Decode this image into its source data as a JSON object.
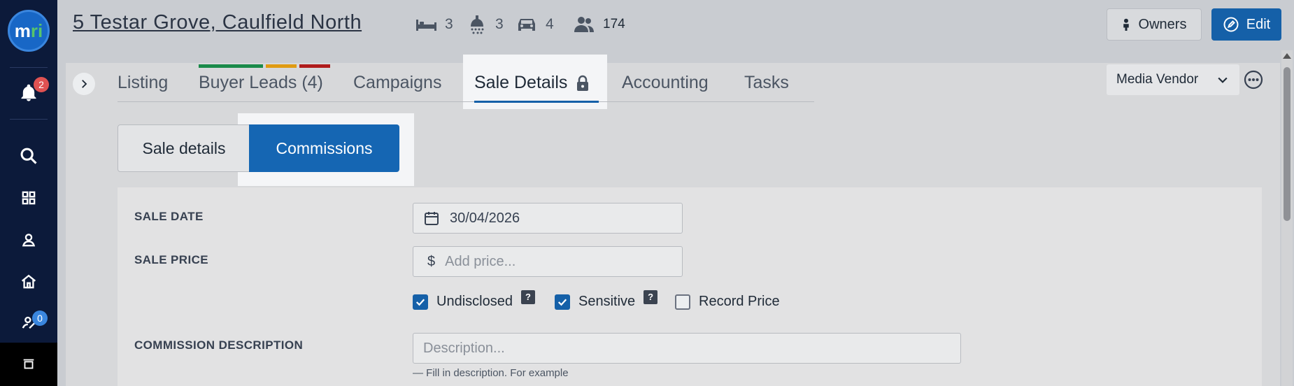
{
  "app": {
    "logo_text": "mri",
    "notifications_count": "2",
    "tasks_count": "0"
  },
  "header": {
    "address": "5 Testar Grove, Caulfield North",
    "bedrooms": "3",
    "bathrooms": "3",
    "car_spaces": "4",
    "contacts": "174",
    "owners_label": "Owners",
    "edit_label": "Edit"
  },
  "tabs": {
    "items": [
      {
        "label": "Listing"
      },
      {
        "label": "Buyer Leads (4)"
      },
      {
        "label": "Campaigns"
      },
      {
        "label": "Sale Details"
      },
      {
        "label": "Accounting"
      },
      {
        "label": "Tasks"
      }
    ],
    "active": "Sale Details",
    "lead_bar_colors": [
      "#1a8a4a",
      "#e09b12",
      "#b01c1c"
    ]
  },
  "vendor_menu": {
    "label": "Media Vendor"
  },
  "subtabs": {
    "sale_details": "Sale details",
    "commissions": "Commissions",
    "active": "Commissions"
  },
  "form": {
    "sale_date_label": "SALE DATE",
    "sale_date_value": "30/04/2026",
    "sale_price_label": "SALE PRICE",
    "currency_symbol": "$",
    "sale_price_placeholder": "Add price...",
    "undisclosed_label": "Undisclosed",
    "undisclosed_checked": true,
    "sensitive_label": "Sensitive",
    "sensitive_checked": true,
    "record_price_label": "Record Price",
    "record_price_checked": false,
    "commission_description_label": "COMMISSION DESCRIPTION",
    "description_placeholder": "Description...",
    "description_hint": "— Fill in description. For example"
  },
  "colors": {
    "nav_bg": "#0c1a3a",
    "primary": "#1560a8",
    "badge_red": "#e05252",
    "badge_blue": "#3a86de"
  }
}
